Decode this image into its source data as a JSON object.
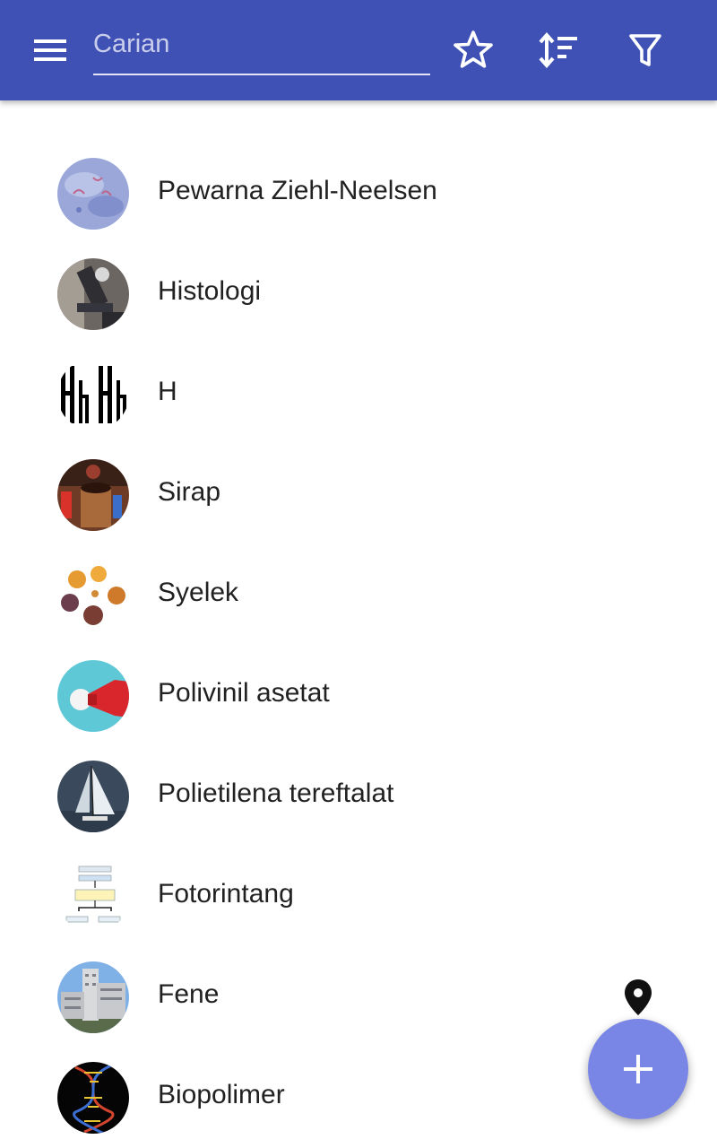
{
  "header": {
    "menu_icon": "hamburger-menu-icon",
    "search": {
      "placeholder": "Carian",
      "value": ""
    },
    "actions": [
      "star-icon",
      "sort-icon",
      "filter-icon"
    ]
  },
  "items": [
    {
      "label": "Pewarna Ziehl-Neelsen",
      "icon": "ziehl-neelsen-thumbnail"
    },
    {
      "label": "Histologi",
      "icon": "microscope-thumbnail"
    },
    {
      "label": "H",
      "icon": "letter-h-thumbnail"
    },
    {
      "label": "Sirap",
      "icon": "syrup-thumbnail"
    },
    {
      "label": "Syelek",
      "icon": "shellac-thumbnail"
    },
    {
      "label": "Polivinil asetat",
      "icon": "glue-bottle-thumbnail"
    },
    {
      "label": "Polietilena tereftalat",
      "icon": "sailboat-thumbnail"
    },
    {
      "label": "Fotorintang",
      "icon": "diagram-thumbnail"
    },
    {
      "label": "Fene",
      "icon": "building-thumbnail"
    },
    {
      "label": "Biopolimer",
      "icon": "dna-thumbnail"
    }
  ],
  "floating": {
    "pin_icon": "map-pin-icon",
    "fab_icon": "plus-icon"
  },
  "colors": {
    "app_bar": "#3f51b5",
    "fab": "#7986e6",
    "text": "#212121"
  }
}
